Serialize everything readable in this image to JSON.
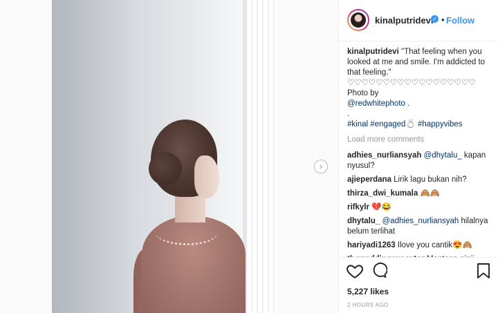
{
  "post": {
    "next_arrow": "›"
  },
  "header": {
    "username": "kinalputridevi",
    "verified_icon": "✓",
    "separator": "•",
    "follow_label": "Follow"
  },
  "caption": {
    "username": "kinalputridevi",
    "text": "\"That feeling when you looked at me and smile. I'm addicted to that feeling.\"",
    "hearts": "♡♡♡♡♡♡♡♡♡♡♡♡♡♡♡♡♡♡",
    "photo_by": " Photo by",
    "photo_credit": "@redwhitephoto",
    "photo_end": " .",
    "dot": ".",
    "tag1": "#kinal",
    "tag2": "#engaged",
    "ring": "💍",
    "tag3": "#happyvibes"
  },
  "load_more": "Load more comments",
  "comments": [
    {
      "user": "adhies_nurliansyah",
      "mention": "@dhytalu_",
      "text": " kapan nyusul?"
    },
    {
      "user": "ajieperdana",
      "text": "Lirik lagu bukan nih?"
    },
    {
      "user": "thirza_dwi_kumala",
      "text": "🙈🙈"
    },
    {
      "user": "rifkylr",
      "text": "💔😂"
    },
    {
      "user": "dhytalu_",
      "mention": "@adhies_nurliansyah",
      "text": " hilalnya belum terlihat"
    },
    {
      "user": "hariyadi1263",
      "text": "Ilove you cantik😍🙈"
    },
    {
      "user": "theweddingexecutor",
      "text": "Mantepp ginii"
    }
  ],
  "actions": {
    "likes": "5,227 likes",
    "timestamp": "2 HOURS AGO"
  }
}
